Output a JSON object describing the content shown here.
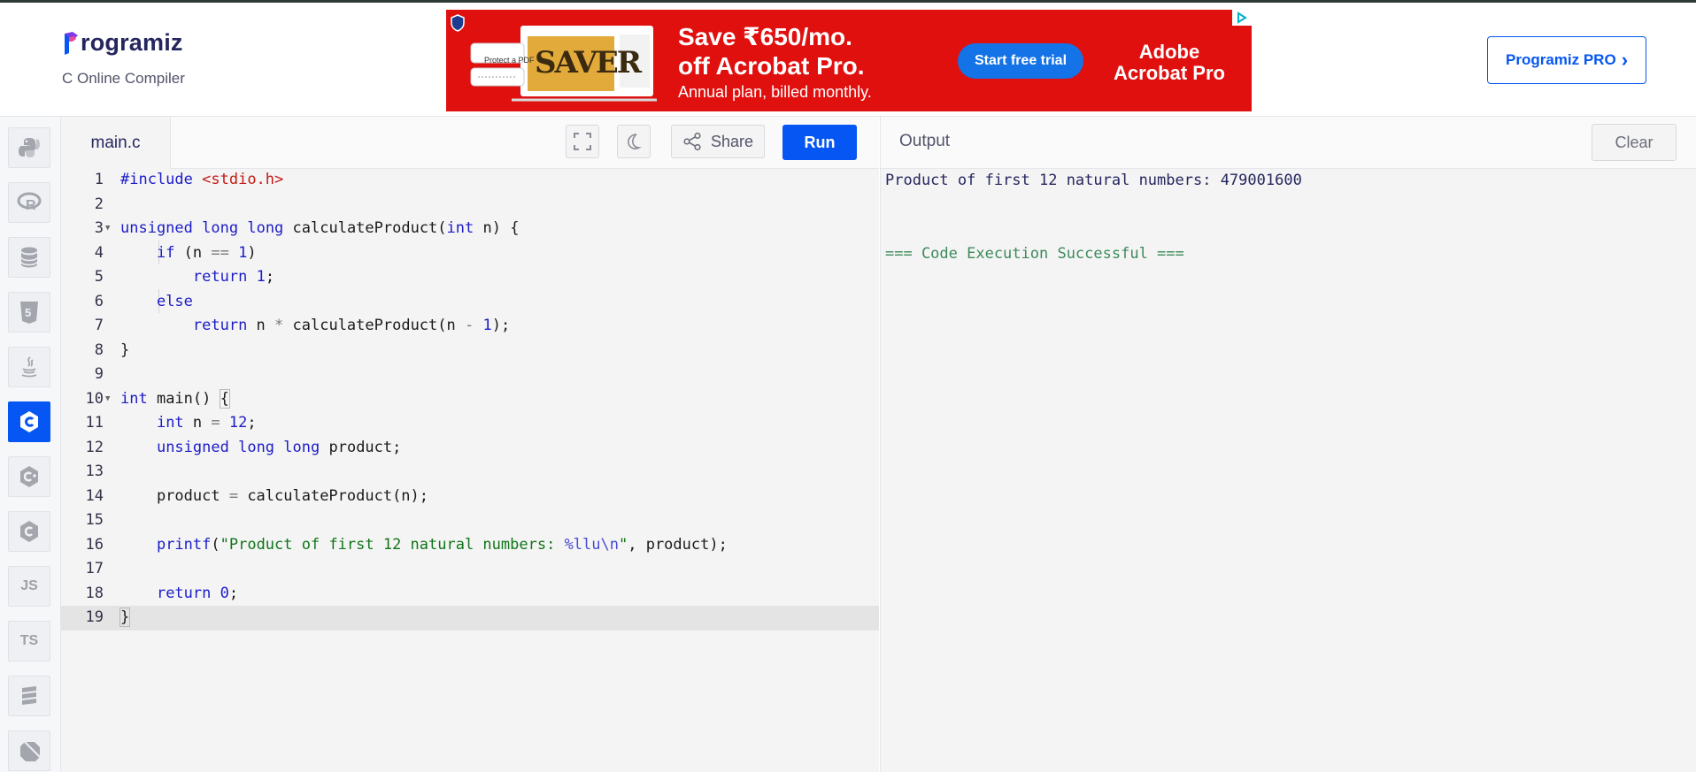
{
  "brand": {
    "name": "rogramiz",
    "subtitle": "C Online Compiler"
  },
  "ad": {
    "headline_1": "Save ₹650/mo.",
    "headline_2": "off Acrobat Pro.",
    "subline": "Annual plan, billed monthly.",
    "cta": "Start free trial",
    "brand_1": "Adobe",
    "brand_2": "Acrobat Pro",
    "mock_button": "Protect a PDF",
    "mock_art": "SAVER"
  },
  "header": {
    "pro_button": "Programiz PRO",
    "pro_chevron": "›"
  },
  "rail": {
    "js_label": "JS",
    "ts_label": "TS"
  },
  "editor": {
    "file_name": "main.c",
    "share_label": "Share",
    "run_label": "Run",
    "line_numbers": [
      "1",
      "2",
      "3",
      "4",
      "5",
      "6",
      "7",
      "8",
      "9",
      "10",
      "11",
      "12",
      "13",
      "14",
      "15",
      "16",
      "17",
      "18",
      "19"
    ],
    "code_lines": [
      "#include <stdio.h>",
      "",
      "unsigned long long calculateProduct(int n) {",
      "    if (n == 1)",
      "        return 1;",
      "    else",
      "        return n * calculateProduct(n - 1);",
      "}",
      "",
      "int main() {",
      "    int n = 12;",
      "    unsigned long long product;",
      "",
      "    product = calculateProduct(n);",
      "",
      "    printf(\"Product of first 12 natural numbers: %llu\\n\", product);",
      "",
      "    return 0;",
      "}"
    ]
  },
  "output": {
    "title": "Output",
    "clear_label": "Clear",
    "result_line": "Product of first 12 natural numbers: 479001600",
    "status_line": "=== Code Execution Successful ==="
  },
  "colors": {
    "accent": "#0556f3",
    "ad_red": "#e0100f",
    "success": "#3d8a5b"
  }
}
